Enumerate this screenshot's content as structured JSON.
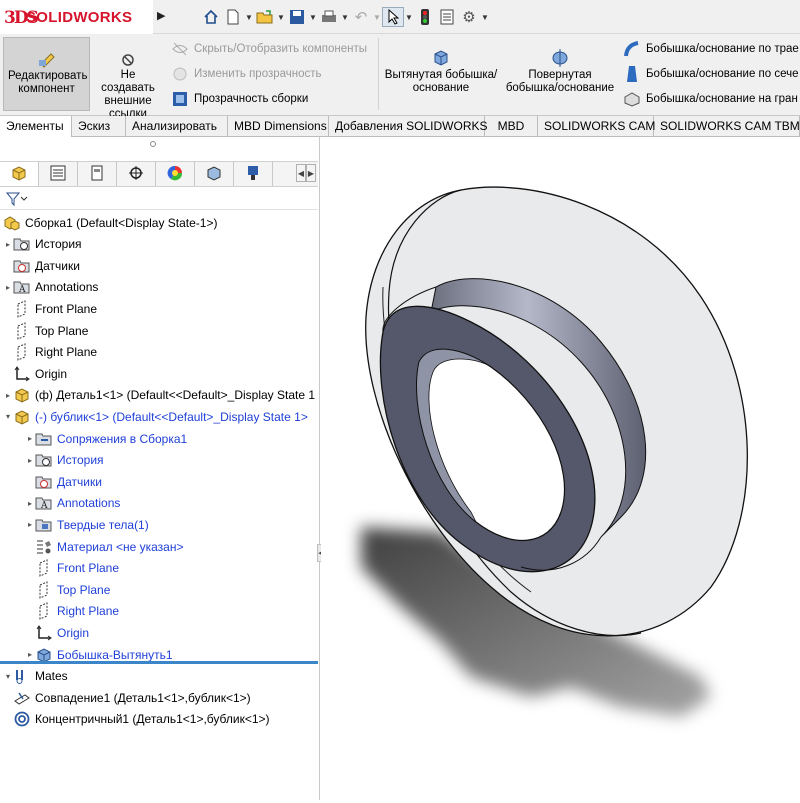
{
  "app": {
    "logo_mark": "3DS",
    "logo_text": "SOLIDWORKS"
  },
  "ribbon": {
    "edit_component": "Редактировать компонент",
    "no_external_refs": "Не создавать внешние ссылки",
    "hide_show_components": "Скрыть/Отобразить компоненты",
    "change_transparency": "Изменить прозрачность",
    "assembly_transparency": "Прозрачность сборки",
    "extruded_boss": "Вытянутая бобышка/основание",
    "revolved_boss": "Повернутая бобышка/основание",
    "swept_boss": "Бобышка/основание по трае",
    "lofted_boss": "Бобышка/основание по сече",
    "boundary_boss": "Бобышка/основание на гран"
  },
  "tabs": [
    "Элементы",
    "Эскиз",
    "Анализировать",
    "MBD Dimensions",
    "Добавления SOLIDWORKS",
    "MBD",
    "SOLIDWORKS CAM",
    "SOLIDWORKS CAM TBM"
  ],
  "active_tab": "Элементы",
  "tree": {
    "root": "Сборка1  (Default<Display State-1>)",
    "items": [
      {
        "label": "История",
        "icon": "history-folder-icon",
        "expandable": true,
        "indent": 1,
        "blue": false
      },
      {
        "label": "Датчики",
        "icon": "sensors-icon",
        "expandable": false,
        "indent": 1,
        "blue": false
      },
      {
        "label": "Annotations",
        "icon": "annotations-icon",
        "expandable": true,
        "indent": 1,
        "blue": false
      },
      {
        "label": "Front Plane",
        "icon": "plane-icon",
        "expandable": false,
        "indent": 1,
        "blue": false
      },
      {
        "label": "Top Plane",
        "icon": "plane-icon",
        "expandable": false,
        "indent": 1,
        "blue": false
      },
      {
        "label": "Right Plane",
        "icon": "plane-icon",
        "expandable": false,
        "indent": 1,
        "blue": false
      },
      {
        "label": "Origin",
        "icon": "origin-icon",
        "expandable": false,
        "indent": 1,
        "blue": false
      },
      {
        "label": "(ф) Деталь1<1> (Default<<Default>_Display State 1",
        "icon": "part-icon",
        "expandable": true,
        "indent": 1,
        "blue": false
      },
      {
        "label": "(-) бублик<1> (Default<<Default>_Display State 1>",
        "icon": "part-icon",
        "expandable": true,
        "expanded": true,
        "indent": 1,
        "blue": true
      },
      {
        "label": "Сопряжения в Сборка1",
        "icon": "mates-folder-icon",
        "expandable": true,
        "indent": 2,
        "blue": true
      },
      {
        "label": "История",
        "icon": "history-folder-icon",
        "expandable": true,
        "indent": 2,
        "blue": true
      },
      {
        "label": "Датчики",
        "icon": "sensors-icon",
        "expandable": false,
        "indent": 2,
        "blue": true
      },
      {
        "label": "Annotations",
        "icon": "annotations-icon",
        "expandable": true,
        "indent": 2,
        "blue": true
      },
      {
        "label": "Твердые тела(1)",
        "icon": "solid-bodies-icon",
        "expandable": true,
        "indent": 2,
        "blue": true
      },
      {
        "label": "Материал <не указан>",
        "icon": "material-icon",
        "expandable": false,
        "indent": 2,
        "blue": true
      },
      {
        "label": "Front Plane",
        "icon": "plane-icon",
        "expandable": false,
        "indent": 2,
        "blue": true
      },
      {
        "label": "Top Plane",
        "icon": "plane-icon",
        "expandable": false,
        "indent": 2,
        "blue": true
      },
      {
        "label": "Right Plane",
        "icon": "plane-icon",
        "expandable": false,
        "indent": 2,
        "blue": true
      },
      {
        "label": "Origin",
        "icon": "origin-icon",
        "expandable": false,
        "indent": 2,
        "blue": true
      },
      {
        "label": "Бобышка-Вытянуть1",
        "icon": "extrude-feature-icon",
        "expandable": true,
        "indent": 2,
        "blue": true
      },
      {
        "label": "Mates",
        "icon": "mates-icon",
        "expandable": true,
        "expanded": true,
        "indent": 0,
        "blue": false
      },
      {
        "label": "Совпадение1 (Деталь1<1>,бублик<1>)",
        "icon": "coincident-mate-icon",
        "expandable": false,
        "indent": 1,
        "blue": false
      },
      {
        "label": "Концентричный1 (Деталь1<1>,бублик<1>)",
        "icon": "concentric-mate-icon",
        "expandable": false,
        "indent": 1,
        "blue": false
      }
    ]
  }
}
